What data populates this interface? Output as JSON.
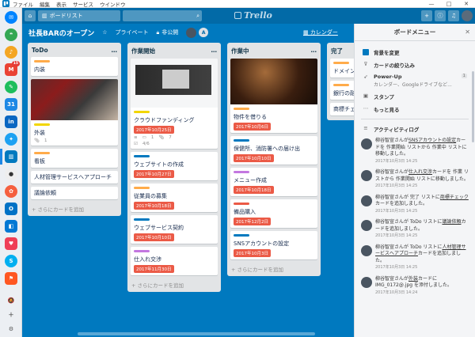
{
  "menubar": {
    "items": [
      "ファイル",
      "編集",
      "表示",
      "サービス",
      "ウインドウ"
    ],
    "controls": [
      "—",
      "□",
      "✕"
    ]
  },
  "dock": {
    "badges": {
      "mail": "15"
    },
    "labels": {
      "calendar": "31",
      "linkedin": "in",
      "gmail": "M"
    }
  },
  "header": {
    "boardlist_label": "ボードリスト",
    "logo": "Trello",
    "search_glyph": "⌕"
  },
  "board": {
    "title": "社長BARのオープン",
    "team_label": "プライベート",
    "visibility_label": "非公開",
    "member_initial": "A",
    "calendar_label": "カレンダー",
    "ellipsis": "…",
    "add_card_label": "+ さらにカードを追加"
  },
  "lists": [
    {
      "title": "ToDo",
      "cards": [
        {
          "title": "内装"
        },
        {
          "title": "外装",
          "badge": "1"
        },
        {
          "title": "看板"
        },
        {
          "title": "人材管理サービスへアプローチ"
        },
        {
          "title": "議論依頼"
        }
      ]
    },
    {
      "title": "作業開始",
      "cards": [
        {
          "title": "クラウドファンディング",
          "due": "2017年10月25日",
          "comments": "1",
          "attachments": "7",
          "checklist": "4/6"
        },
        {
          "title": "ウェブサイトの作成",
          "due": "2017年10月27日"
        },
        {
          "title": "従業員の募集",
          "due": "2017年10月18日"
        },
        {
          "title": "ウェブサービス契約",
          "due": "2017年10月10日"
        },
        {
          "title": "仕入れ交渉",
          "due": "2017年11月30日"
        }
      ]
    },
    {
      "title": "作業中",
      "cards": [
        {
          "title": "物件を借りる",
          "due": "2017年10月6日"
        },
        {
          "title": "保健所、消防署への届け出",
          "due": "2017年10月10日"
        },
        {
          "title": "メニュー作成",
          "due": "2017年10月18日"
        },
        {
          "title": "備品購入",
          "due": "2017年12月2日"
        },
        {
          "title": "SNSアカウントの設定",
          "due": "2017年10月3日"
        }
      ]
    },
    {
      "title": "完了",
      "cards": [
        {
          "title": "ドメイン"
        },
        {
          "title": "銀行の融資"
        },
        {
          "title": "商標チェック"
        }
      ]
    }
  ],
  "menu": {
    "title": "ボードメニュー",
    "items": [
      {
        "label": "背景を変更"
      },
      {
        "label": "カードの絞り込み"
      },
      {
        "label": "Power-Up",
        "sub": "カレンダー、Googleドライブなど...",
        "count": "1"
      },
      {
        "label": "スタンプ"
      },
      {
        "label": "もっと見る"
      }
    ],
    "activity_title": "アクティビティログ",
    "activities": [
      {
        "pre": "柳谷智宣さんが",
        "link": "SNSアカウントの設定",
        "post": "カードを 作業開始 リストから 作業中 リストに移動しました。",
        "time": "2017年10月3日 14:25"
      },
      {
        "pre": "柳谷智宣さんが",
        "link": "仕入れ交渉",
        "post": "カードを 作業 リストから 作業開始 リストに移動しました。",
        "time": "2017年10月3日 14:25"
      },
      {
        "pre": "柳谷智宣さんが 完了 リストに",
        "link": "商標チェック",
        "post": "カードを追加しました。",
        "time": "2017年10月3日 14:25"
      },
      {
        "pre": "柳谷智宣さんが ToDo リストに",
        "link": "議論依頼",
        "post": "カードを追加しました。",
        "time": "2017年10月3日 14:25"
      },
      {
        "pre": "柳谷智宣さんが ToDo リストに",
        "link": "人材管理サービスへアプローチ",
        "post": "カードを追加しました。",
        "time": "2017年10月3日 14:25"
      },
      {
        "pre": "柳谷智宣さんが",
        "link": "外装",
        "post": "カードに IMG_0172@.jpg を添付しました。",
        "time": "2017年10月3日 14:24"
      }
    ]
  }
}
